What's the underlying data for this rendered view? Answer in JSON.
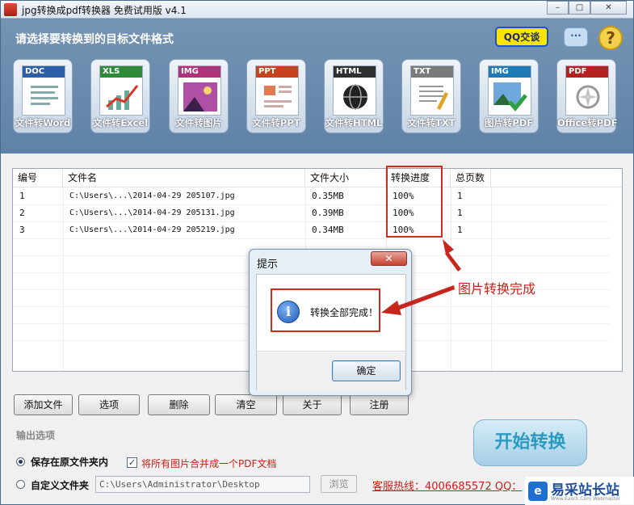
{
  "window": {
    "title": "jpg转换成pdf转换器 免费试用版 v4.1"
  },
  "header": {
    "select_title": "请选择要转换到的目标文件格式",
    "qq_label": "QQ交谈",
    "tools": [
      {
        "tag": "DOC",
        "label": "文件转Word",
        "color": "#2b5ea8"
      },
      {
        "tag": "XLS",
        "label": "文件转Excel",
        "color": "#2e8b3a"
      },
      {
        "tag": "IMG",
        "label": "文件转图片",
        "color": "#b0327a"
      },
      {
        "tag": "PPT",
        "label": "文件转PPT",
        "color": "#c9421f"
      },
      {
        "tag": "HTML",
        "label": "文件转HTML",
        "color": "#303030"
      },
      {
        "tag": "TXT",
        "label": "文件转TXT",
        "color": "#7a7a7a"
      },
      {
        "tag": "IMG",
        "label": "图片转PDF",
        "color": "#1f7ab8"
      },
      {
        "tag": "PDF",
        "label": "Office转PDF",
        "color": "#b52020"
      }
    ]
  },
  "table": {
    "columns": [
      "编号",
      "文件名",
      "文件大小",
      "转换进度",
      "总页数"
    ],
    "rows": [
      {
        "id": "1",
        "name": "C:\\Users\\...\\2014-04-29 205107.jpg",
        "size": "0.35MB",
        "progress": "100%",
        "pages": "1"
      },
      {
        "id": "2",
        "name": "C:\\Users\\...\\2014-04-29 205131.jpg",
        "size": "0.39MB",
        "progress": "100%",
        "pages": "1"
      },
      {
        "id": "3",
        "name": "C:\\Users\\...\\2014-04-29 205219.jpg",
        "size": "0.34MB",
        "progress": "100%",
        "pages": "1"
      }
    ]
  },
  "annotation": {
    "callout": "图片转换完成"
  },
  "dialog": {
    "title": "提示",
    "close": "✕",
    "message": "转换全部完成！",
    "ok": "确定"
  },
  "actions": {
    "add_file": "添加文件",
    "options": "选项",
    "delete": "删除",
    "clear": "清空",
    "about": "关于",
    "register": "注册"
  },
  "output": {
    "section_label": "输出选项",
    "save_original": "保存在原文件夹内",
    "merge_label": "将所有图片合并成一个PDF文档",
    "custom_folder": "自定义文件夹",
    "path": "C:\\Users\\Administrator\\Desktop",
    "browse": "浏览",
    "start": "开始转换",
    "hotline": "客服热线：4006685572 QQ："
  },
  "watermark": {
    "text": "易采站长站",
    "sub": "Www.Easck.Com Webmaster"
  }
}
